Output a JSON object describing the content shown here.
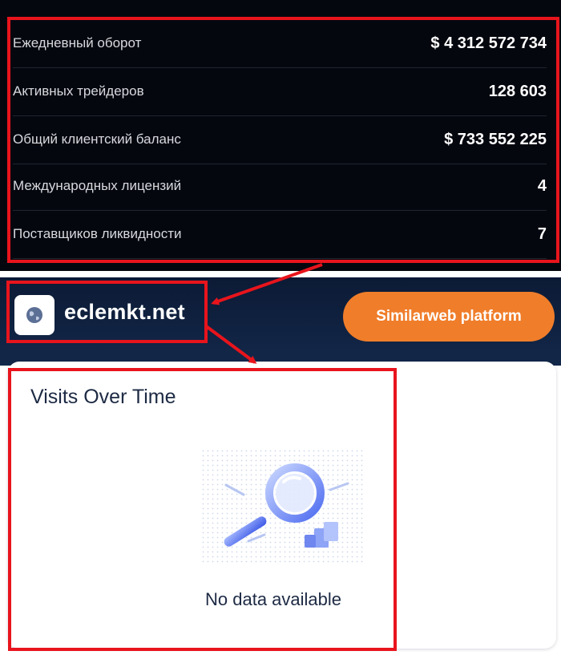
{
  "stats": [
    {
      "label": "Ежедневный оборот",
      "value": "$ 4 312 572 734"
    },
    {
      "label": "Активных трейдеров",
      "value": "128 603"
    },
    {
      "label": "Общий клиентский баланс",
      "value": "$ 733 552 225"
    },
    {
      "label": "Международных лицензий",
      "value": "4"
    },
    {
      "label": "Поставщиков ликвидности",
      "value": "7"
    }
  ],
  "site": {
    "domain": "eclemkt.net",
    "favicon_icon": "globe-icon",
    "platform_button": "Similarweb platform"
  },
  "visits_card": {
    "title": "Visits Over Time",
    "illustration_icon": "magnifier-icon",
    "empty_text": "No data available"
  },
  "colors": {
    "annotation": "#e8141c",
    "button": "#f07d2a",
    "header_bg": "#0c1a35"
  }
}
